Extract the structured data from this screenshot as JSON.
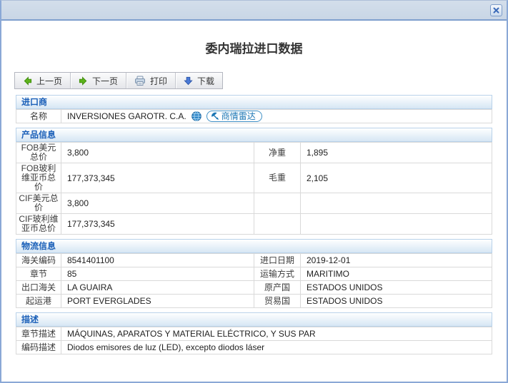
{
  "title": "委内瑞拉进口数据",
  "window": {
    "close_glyph": "✕"
  },
  "toolbar": {
    "prev_label": "上一页",
    "next_label": "下一页",
    "print_label": "打印",
    "download_label": "下载"
  },
  "sections": {
    "importer": {
      "header": "进口商",
      "name_label": "名称",
      "name_value": "INVERSIONES GAROTR. C.A.",
      "radar_badge": "商情雷达"
    },
    "product": {
      "header": "产品信息",
      "rows": [
        {
          "label": "FOB美元总价",
          "value": "3,800",
          "label2": "净重",
          "value2": "1,895"
        },
        {
          "label": "FOB玻利维亚币总价",
          "value": "177,373,345",
          "label2": "毛重",
          "value2": "2,105"
        },
        {
          "label": "CIF美元总价",
          "value": "3,800",
          "label2": "",
          "value2": ""
        },
        {
          "label": "CIF玻利维亚币总价",
          "value": "177,373,345",
          "label2": "",
          "value2": ""
        }
      ]
    },
    "logistics": {
      "header": "物流信息",
      "rows": [
        {
          "label": "海关编码",
          "value": "8541401100",
          "label2": "进口日期",
          "value2": "2019-12-01"
        },
        {
          "label": "章节",
          "value": "85",
          "label2": "运输方式",
          "value2": "MARITIMO"
        },
        {
          "label": "出口海关",
          "value": "LA GUAIRA",
          "label2": "原产国",
          "value2": "ESTADOS UNIDOS"
        },
        {
          "label": "起运港",
          "value": "PORT EVERGLADES",
          "label2": "贸易国",
          "value2": "ESTADOS UNIDOS"
        }
      ]
    },
    "description": {
      "header": "描述",
      "rows": [
        {
          "label": "章节描述",
          "value": "MÁQUINAS, APARATOS Y MATERIAL ELÉCTRICO, Y SUS PAR"
        },
        {
          "label": "编码描述",
          "value": "Diodos emisores de luz (LED), excepto diodos láser"
        }
      ]
    }
  },
  "icons": {
    "close": "x-cross",
    "prev": "green-arrow-left",
    "next": "green-arrow-right",
    "print": "printer",
    "download": "blue-arrow-down",
    "website": "globe",
    "radar": "satellite-dish"
  },
  "colors": {
    "titlebar": "#cdd9e8",
    "window_border": "#8aa8d6",
    "section_header_text": "#1a5fb8",
    "section_header_bg": "#d6e6f4",
    "arrow_green": "#4ea613",
    "arrow_blue": "#3a6cd0",
    "badge_blue": "#1b76b4"
  }
}
